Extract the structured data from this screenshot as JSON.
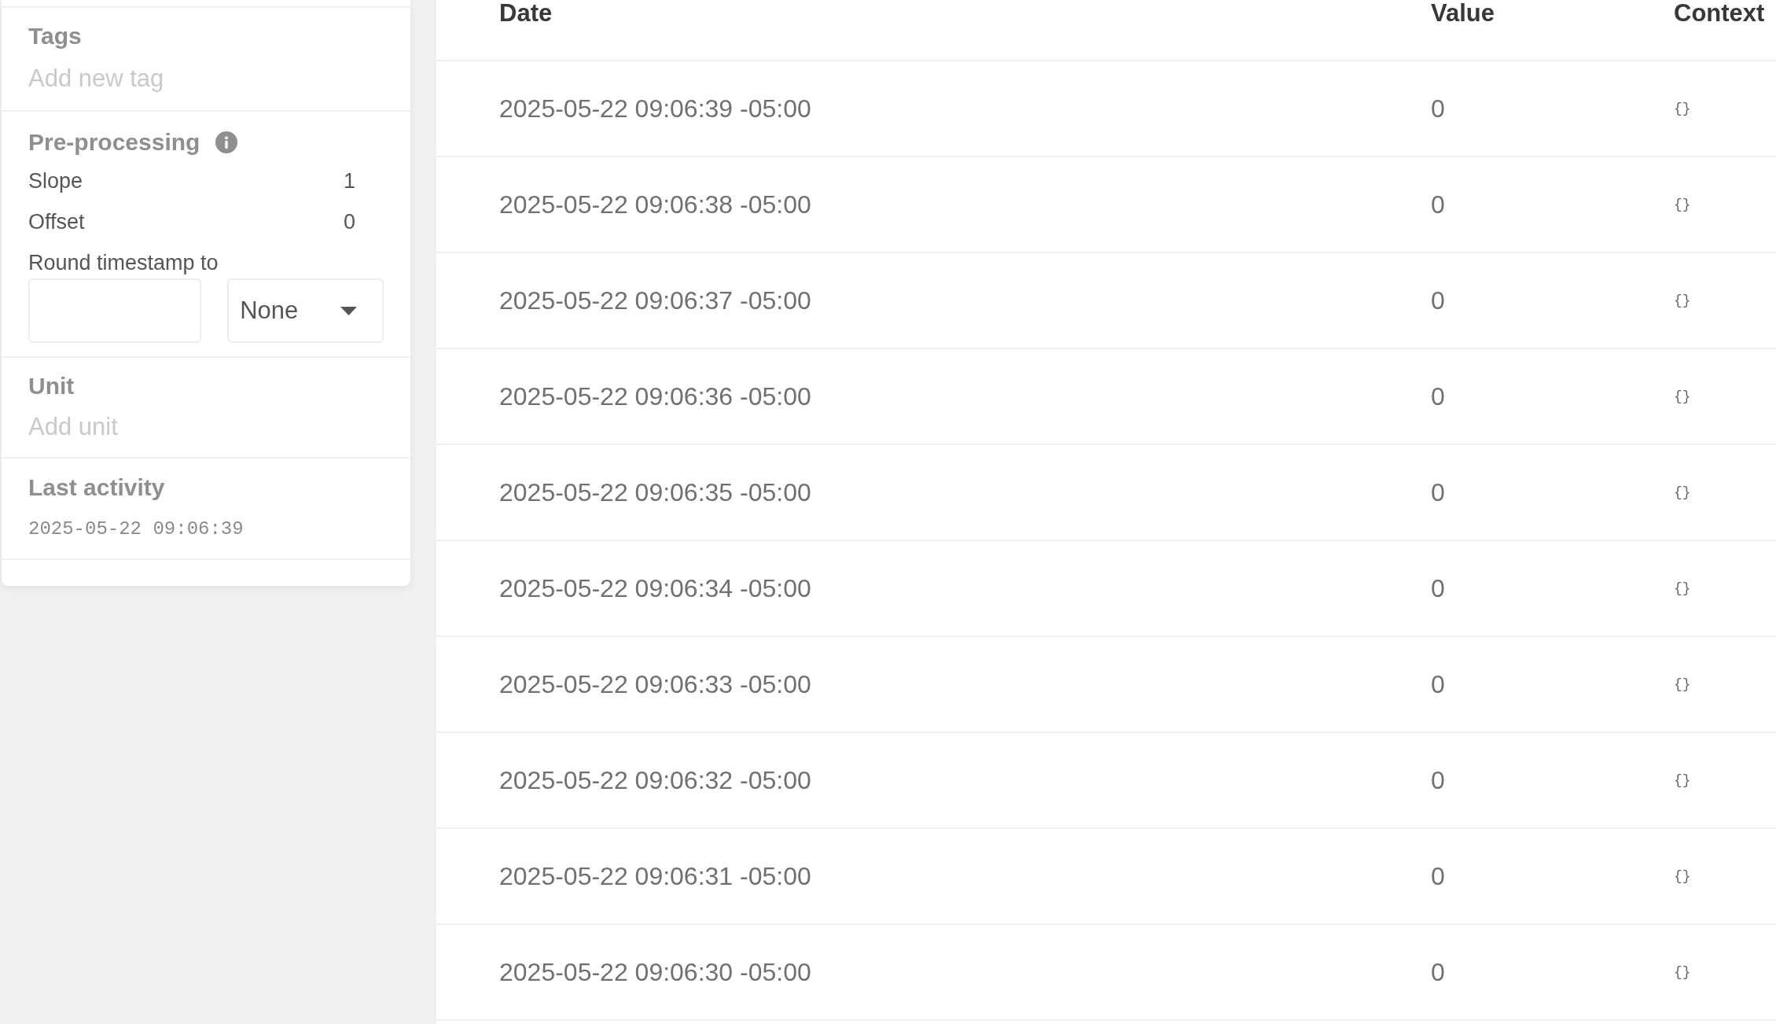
{
  "sidebar": {
    "tags": {
      "title": "Tags",
      "placeholder": "Add new tag"
    },
    "preprocessing": {
      "title": "Pre-processing",
      "params": [
        {
          "label": "Slope",
          "value": "1"
        },
        {
          "label": "Offset",
          "value": "0"
        }
      ],
      "round_timestamp": {
        "label": "Round timestamp to",
        "unit": "None"
      }
    },
    "unit": {
      "title": "Unit",
      "placeholder": "Add unit"
    },
    "last_activity": {
      "title": "Last activity",
      "value": "2025-05-22 09:06:39"
    }
  },
  "table": {
    "columns": [
      "Date",
      "Value",
      "Context"
    ],
    "rows": [
      {
        "date": "2025-05-22 09:06:39 -05:00",
        "value": "0",
        "context": "{}"
      },
      {
        "date": "2025-05-22 09:06:38 -05:00",
        "value": "0",
        "context": "{}"
      },
      {
        "date": "2025-05-22 09:06:37 -05:00",
        "value": "0",
        "context": "{}"
      },
      {
        "date": "2025-05-22 09:06:36 -05:00",
        "value": "0",
        "context": "{}"
      },
      {
        "date": "2025-05-22 09:06:35 -05:00",
        "value": "0",
        "context": "{}"
      },
      {
        "date": "2025-05-22 09:06:34 -05:00",
        "value": "0",
        "context": "{}"
      },
      {
        "date": "2025-05-22 09:06:33 -05:00",
        "value": "0",
        "context": "{}"
      },
      {
        "date": "2025-05-22 09:06:32 -05:00",
        "value": "0",
        "context": "{}"
      },
      {
        "date": "2025-05-22 09:06:31 -05:00",
        "value": "0",
        "context": "{}"
      },
      {
        "date": "2025-05-22 09:06:30 -05:00",
        "value": "0",
        "context": "{}"
      }
    ]
  }
}
